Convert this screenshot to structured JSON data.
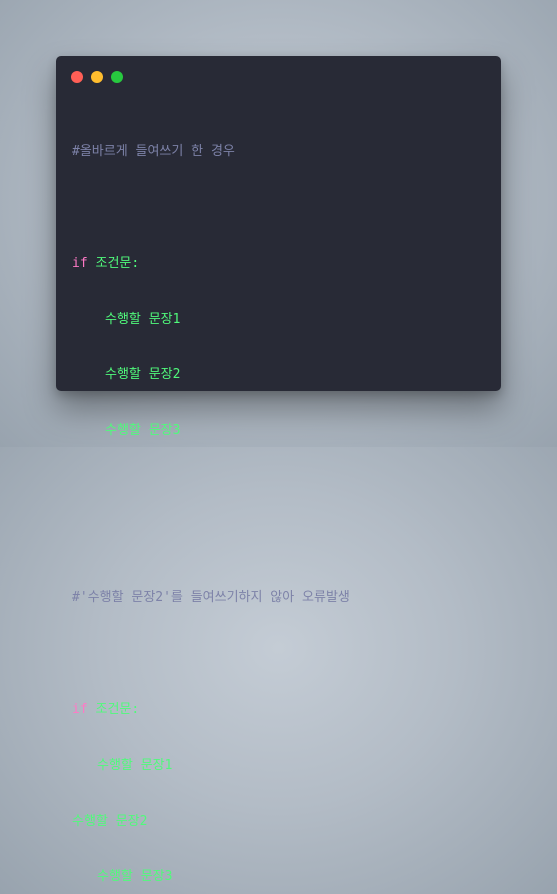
{
  "colors": {
    "background": "#b3bcc6",
    "editor_bg": "#282a36",
    "comment": "#7d82a8",
    "keyword": "#ff79c6",
    "code_text": "#50fa7b",
    "close_dot": "#ff5f56",
    "minimize_dot": "#ffbd2e",
    "maximize_dot": "#27c93f"
  },
  "window": {
    "buttons": [
      "close",
      "minimize",
      "maximize"
    ]
  },
  "code": {
    "block1": {
      "comment": "#올바르게 들여쓰기 한 경우",
      "keyword": "if",
      "condition": " 조건문:",
      "lines": [
        "수행할 문장1",
        "수행할 문장2",
        "수행할 문장3"
      ]
    },
    "block2": {
      "comment": "#'수행할 문장2'를 들여쓰기하지 않아 오류발생",
      "keyword": "if",
      "condition": " 조건문:",
      "line1": "수행할 문장1",
      "line2": "수행할 문장2",
      "line3": "수행할 문장3"
    }
  }
}
